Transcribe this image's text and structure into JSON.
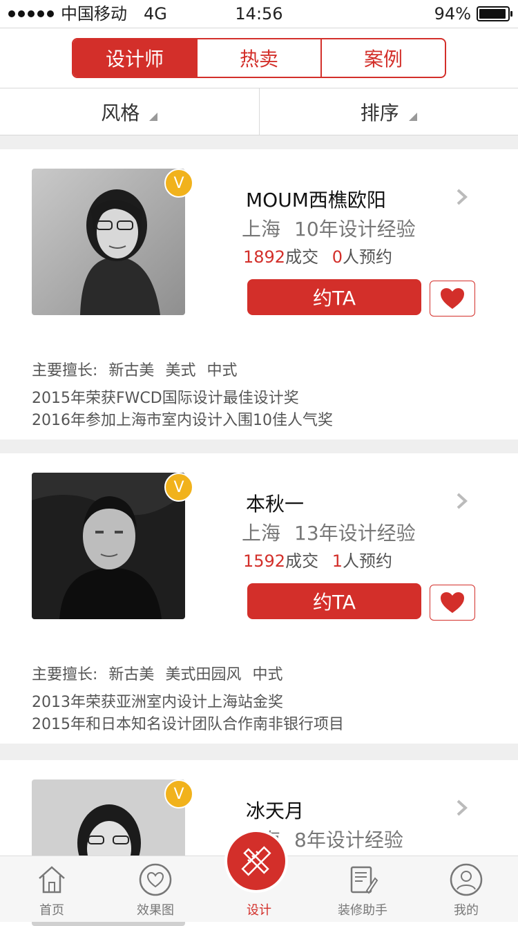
{
  "status": {
    "carrier": "中国移动",
    "network": "4G",
    "time": "14:56",
    "battery": "94%"
  },
  "segments": [
    "设计师",
    "热卖",
    "案例"
  ],
  "filters": [
    "风格",
    "排序"
  ],
  "designers": [
    {
      "name": "MOUM西樵欧阳",
      "city": "上海",
      "experience": "10年设计经验",
      "deals_count": "1892",
      "deals_label": "成交",
      "booked_count": "0",
      "booked_label": "人预约",
      "book_label": "约TA",
      "specialty_label": "主要擅长:",
      "specialties": [
        "新古美",
        "美式",
        "中式"
      ],
      "awards": [
        "2015年荣获FWCD国际设计最佳设计奖",
        "2016年参加上海市室内设计入围10佳人气奖"
      ]
    },
    {
      "name": "本秋一",
      "city": "上海",
      "experience": "13年设计经验",
      "deals_count": "1592",
      "deals_label": "成交",
      "booked_count": "1",
      "booked_label": "人预约",
      "book_label": "约TA",
      "specialty_label": "主要擅长:",
      "specialties": [
        "新古美",
        "美式田园风",
        "中式"
      ],
      "awards": [
        "2013年荣获亚洲室内设计上海站金奖",
        "2015年和日本知名设计团队合作南非银行项目"
      ]
    },
    {
      "name": "冰天月",
      "city": "上海",
      "experience": "8年设计经验"
    }
  ],
  "verified_badge": "V",
  "tabs": [
    "首页",
    "效果图",
    "设计",
    "装修助手",
    "我的"
  ],
  "colors": {
    "accent": "#d32f2a",
    "badge": "#f1b21c"
  }
}
